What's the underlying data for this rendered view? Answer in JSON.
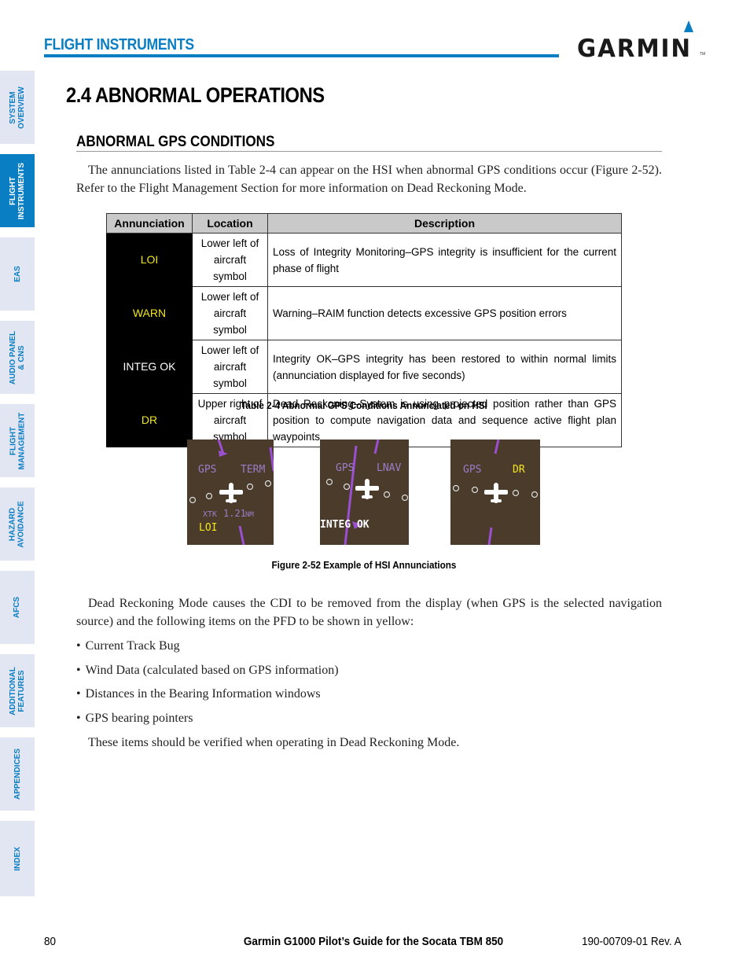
{
  "header": {
    "section_title": "FLIGHT INSTRUMENTS",
    "logo_text": "GARMIN",
    "logo_tm": "TM",
    "accent_color": "#0a7ec2"
  },
  "sidebar": {
    "items": [
      {
        "label": "SYSTEM\nOVERVIEW",
        "active": false
      },
      {
        "label": "FLIGHT\nINSTRUMENTS",
        "active": true
      },
      {
        "label": "EAS",
        "active": false
      },
      {
        "label": "AUDIO PANEL\n& CNS",
        "active": false
      },
      {
        "label": "FLIGHT\nMANAGEMENT",
        "active": false
      },
      {
        "label": "HAZARD\nAVOIDANCE",
        "active": false
      },
      {
        "label": "AFCS",
        "active": false
      },
      {
        "label": "ADDITIONAL\nFEATURES",
        "active": false
      },
      {
        "label": "APPENDICES",
        "active": false
      },
      {
        "label": "INDEX",
        "active": false
      }
    ]
  },
  "main": {
    "heading": "2.4  ABNORMAL OPERATIONS",
    "subheading": "ABNORMAL GPS CONDITIONS",
    "intro_paragraph": "The annunciations listed in Table 2-4 can appear on the HSI when abnormal GPS conditions occur (Figure 2-52).  Refer to the Flight Management Section for more information on Dead Reckoning Mode.",
    "table": {
      "headers": [
        "Annunciation",
        "Location",
        "Description"
      ],
      "rows": [
        {
          "annunciation": "LOI",
          "color": "yellow",
          "location": "Lower left of aircraft symbol",
          "description": "Loss of Integrity Monitoring–GPS integrity is insufficient for the current phase of flight"
        },
        {
          "annunciation": "WARN",
          "color": "yellow",
          "location": "Lower left of aircraft symbol",
          "description": "Warning–RAIM function detects excessive GPS position errors"
        },
        {
          "annunciation": "INTEG OK",
          "color": "white",
          "location": "Lower left of aircraft symbol",
          "description": "Integrity OK–GPS integrity has been restored to within normal limits (annunciation displayed for five seconds)"
        },
        {
          "annunciation": "DR",
          "color": "yellow",
          "location": "Upper right of aircraft symbol",
          "description": "Dead Reckoning–System is using projected position rather than GPS position to compute navigation data and sequence active flight plan waypoints"
        }
      ],
      "caption": "Table 2-4  Abnormal GPS Conditions Annunciated on HSI"
    },
    "figure": {
      "panels": [
        {
          "source": "GPS",
          "mode": "TERM",
          "xtk_label": "XTK",
          "xtk_value": "1.21",
          "xtk_unit": "NM",
          "annunciation": "LOI"
        },
        {
          "source": "GPS",
          "mode": "LNAV",
          "annunciation": "INTEG OK"
        },
        {
          "source": "GPS",
          "annunciation": "DR"
        }
      ],
      "caption": "Figure 2-52  Example of HSI Annunciations"
    },
    "dr_paragraph": "Dead Reckoning Mode causes the CDI to be removed from the display (when GPS is the selected navigation source) and the following items on the PFD to be shown in yellow:",
    "bullets": [
      "Current Track Bug",
      "Wind Data (calculated based on GPS information)",
      "Distances in the Bearing Information windows",
      "GPS bearing pointers"
    ],
    "closing_paragraph": "These items should be verified when operating in Dead Reckoning Mode."
  },
  "footer": {
    "page_number": "80",
    "title": "Garmin G1000 Pilot’s Guide for the Socata TBM 850",
    "doc_number": "190-00709-01  Rev. A"
  }
}
